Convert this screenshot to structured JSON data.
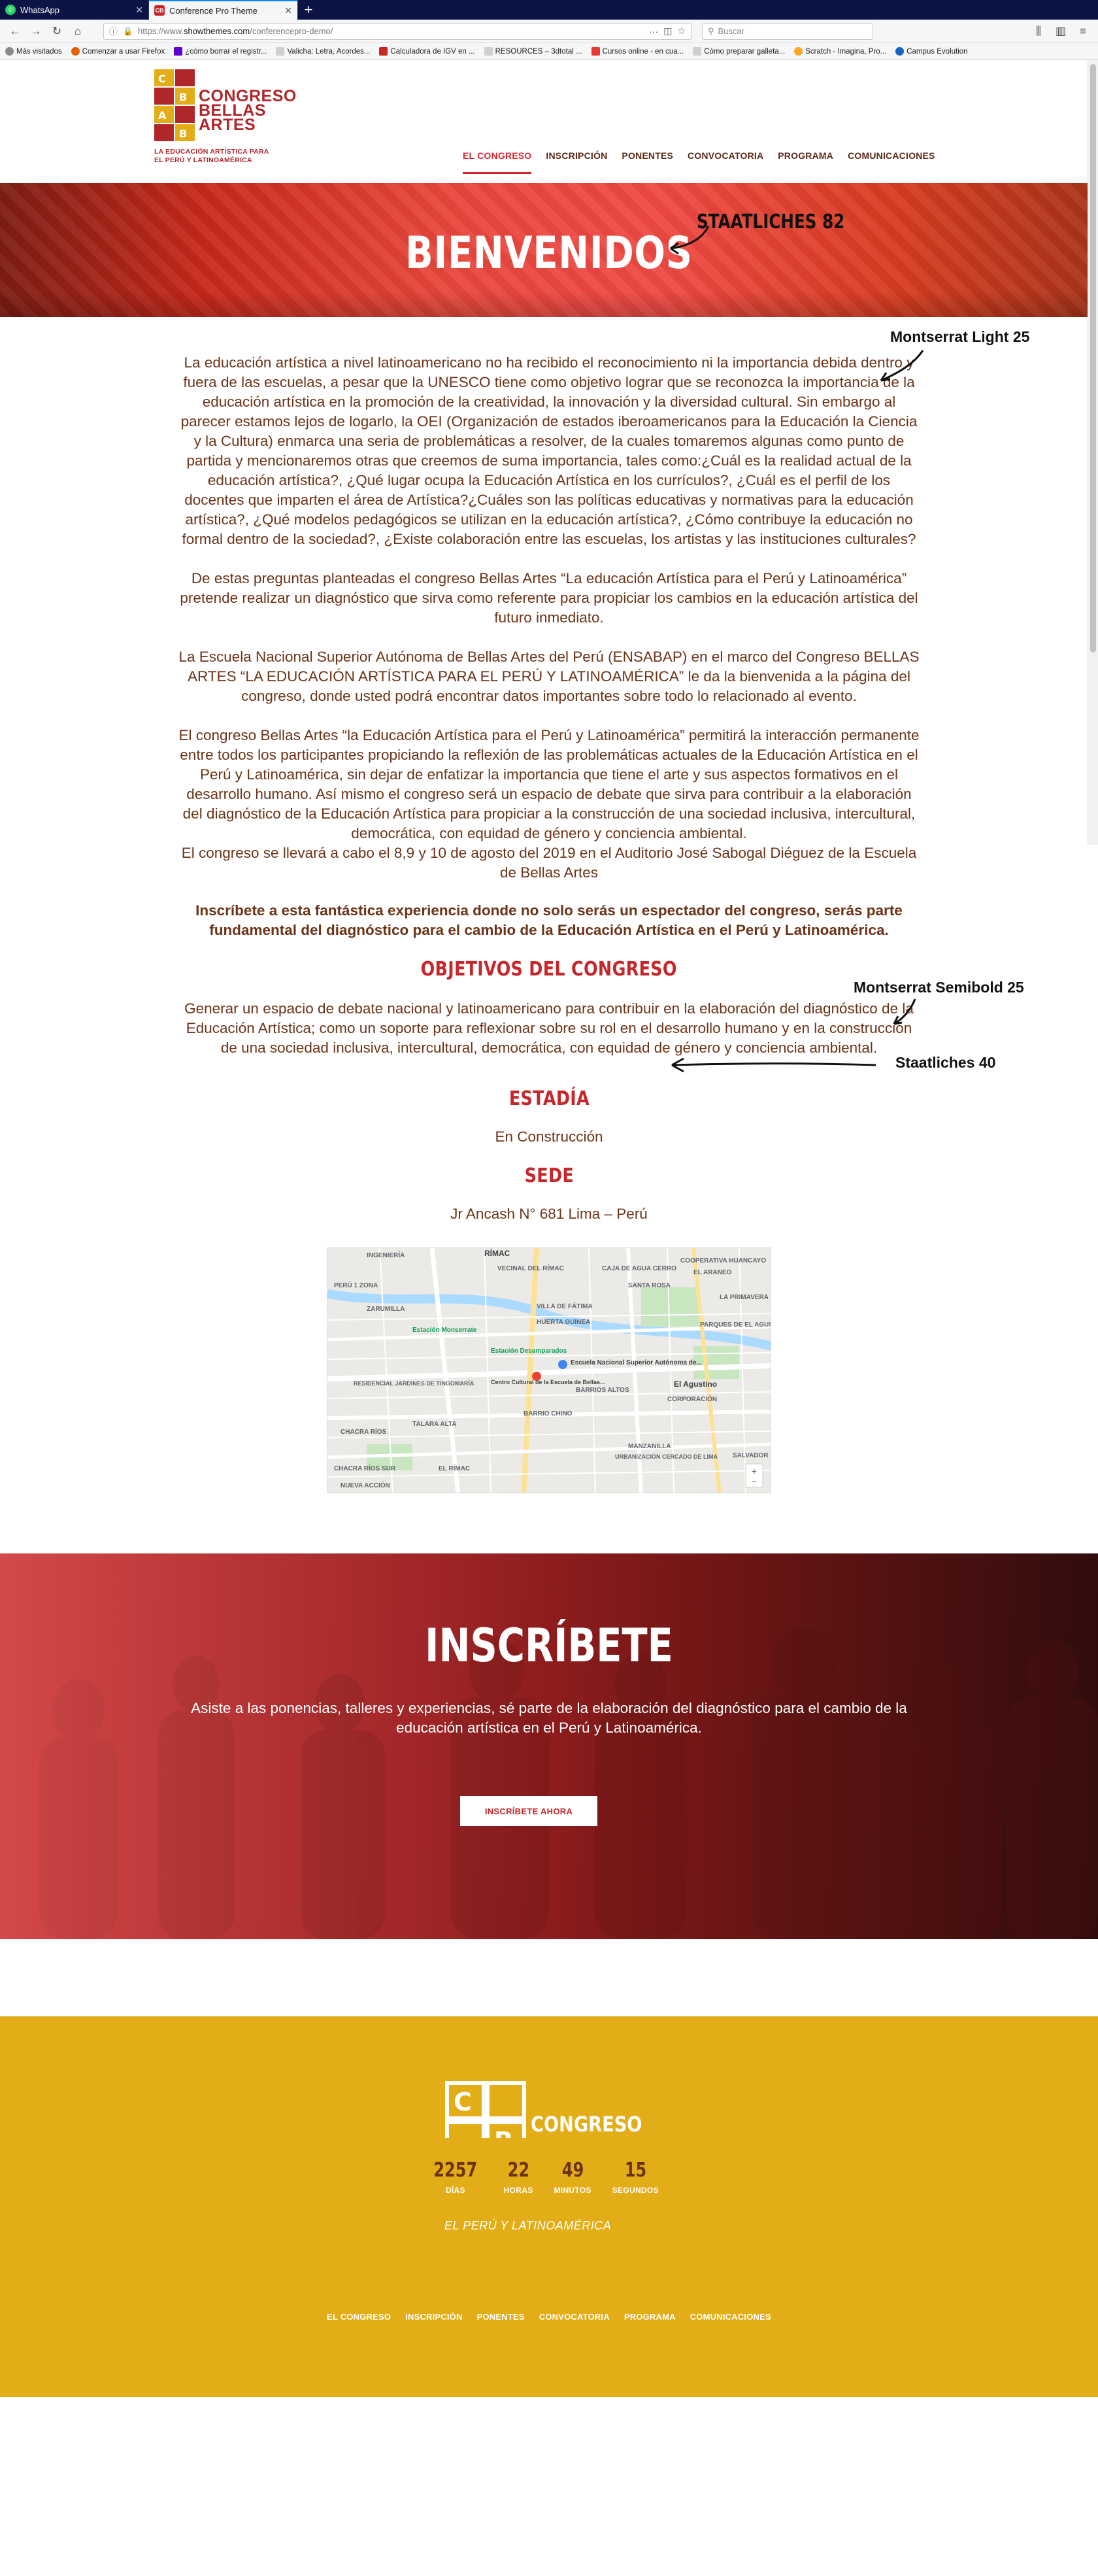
{
  "browser": {
    "tabs": [
      {
        "label": "WhatsApp",
        "favicon": "whatsapp-icon"
      },
      {
        "label": "Conference Pro Theme",
        "favicon": "cb-icon",
        "active": true
      }
    ],
    "url_prefix": "https://www.",
    "url_domain": "showthemes.com",
    "url_path": "/conferencepro-demo/",
    "search_placeholder": "Buscar",
    "bookmarks": [
      "Más visitados",
      "Comenzar a usar Firefox",
      "¿cómo borrar el registr...",
      "Valicha: Letra, Acordes...",
      "Calculadora de IGV en ...",
      "RESOURCES – 3dtotal ...",
      "Cursos online - en cua...",
      "Cómo preparar galleta...",
      "Scratch - Imagina, Pro...",
      "Campus Evolution"
    ]
  },
  "logo": {
    "word1": "CONGRESO",
    "word2": "BELLAS",
    "word3": "ARTES",
    "tag_line1": "LA EDUCACIÓN ARTÍSTICA PARA",
    "tag_line2": "EL PERÚ Y LATINOAMÉRICA",
    "brand_red": "#b0262a",
    "brand_yellow": "#e3ad17"
  },
  "nav": [
    {
      "label": "EL CONGRESO",
      "active": true
    },
    {
      "label": "INSCRIPCIÓN"
    },
    {
      "label": "PONENTES"
    },
    {
      "label": "CONVOCATORIA"
    },
    {
      "label": "PROGRAMA"
    },
    {
      "label": "COMUNICACIONES"
    }
  ],
  "hero": {
    "title": "BIENVENIDOS"
  },
  "annotations": {
    "staatliches82": "STAATLICHES 82",
    "montserrat_light": "Montserrat Light 25",
    "montserrat_semibold": "Montserrat Semibold 25",
    "staatliches40": "Staatliches 40"
  },
  "intro": {
    "p1": "La educación artística a nivel latinoamericano no ha recibido el reconocimiento ni la importancia debida dentro y fuera de las escuelas, a pesar que la UNESCO tiene como objetivo lograr que se reconozca la importancia de la educación artística en la promoción de la creatividad, la innovación y la diversidad cultural. Sin embargo al parecer estamos lejos de logarlo, la OEI (Organización de estados iberoamericanos para la Educación la Ciencia y la Cultura) enmarca una seria de problemáticas a resolver, de la cuales tomaremos algunas como punto de partida y mencionaremos otras que creemos de suma importancia, tales como:¿Cuál es la realidad actual de la educación artística?, ¿Qué lugar ocupa la Educación Artística en los currículos?, ¿Cuál es el perfil de los docentes que imparten el área de Artística?¿Cuáles son las políticas educativas y normativas para la educación artística?, ¿Qué modelos pedagógicos se utilizan en la educación artística?,  ¿Cómo contribuye la educación no formal dentro de la sociedad?, ¿Existe colaboración entre las escuelas, los artistas y las instituciones culturales?",
    "p2": "De estas preguntas planteadas el congreso Bellas Artes “La educación Artística para el Perú y Latinoamérica” pretende realizar un diagnóstico que sirva como referente para propiciar los cambios en la educación artística del futuro inmediato.",
    "p3": "La Escuela Nacional Superior Autónoma de Bellas Artes del Perú (ENSABAP) en el marco del Congreso BELLAS ARTES “LA EDUCACIÓN ARTÍSTICA PARA EL PERÚ Y LATINOAMÉRICA” le da la bienvenida a la página del congreso, donde usted podrá encontrar datos importantes sobre todo lo relacionado al evento.",
    "p4": "El congreso Bellas Artes “la Educación Artística para el Perú y Latinoamérica” permitirá la interacción permanente entre todos los participantes propiciando la reflexión de las problemáticas actuales de la Educación Artística en el Perú y Latinoamérica, sin dejar de enfatizar la importancia que tiene el arte y sus aspectos formativos en el desarrollo humano. Así mismo el congreso será un espacio de debate que sirva para contribuir a la elaboración del diagnóstico de la Educación Artística para propiciar a la construcción de una sociedad inclusiva, intercultural, democrática, con equidad de género y conciencia ambiental.",
    "p4b": "El congreso se llevará a cabo el 8,9 y 10 de agosto del 2019 en el Auditorio José Sabogal Diéguez de la Escuela de Bellas Artes",
    "p5": "Inscríbete a esta fantástica experiencia donde no solo serás un espectador del congreso, serás parte fundamental del diagnóstico para el cambio de la Educación Artística en el Perú y Latinoamérica."
  },
  "objetivos": {
    "title": "OBJETIVOS DEL CONGRESO",
    "text": "Generar un espacio de debate nacional y latinoamericano para contribuir en la elaboración del diagnóstico de la Educación Artística; como un soporte para reflexionar sobre su rol en el desarrollo humano y en la construcción de una sociedad inclusiva, intercultural, democrática, con equidad de género y conciencia ambiental."
  },
  "estadia": {
    "title": "ESTADÍA",
    "text": "En Construcción"
  },
  "sede": {
    "title": "SEDE",
    "text": "Jr Ancash N° 681 Lima – Perú"
  },
  "map": {
    "labels": [
      "INGENIERÍA",
      "RÍMAC",
      "PERÚ 1 ZONA",
      "ZARUMILLA",
      "VILLA DE FÁTIMA",
      "HUERTA GUINEA",
      "Estación Monserrate",
      "Estación Desamparados",
      "Escuela Nacional Superior Autónoma de...",
      "Centro Cultural de la Escuela de Bellas...",
      "BARRIOS ALTOS",
      "El Agustino",
      "CORPORACIÓN",
      "BARRIO CHINO",
      "RESIDENCIAL JARDINES DE TINGOMARÍA",
      "TALARA ALTA",
      "CHACRA RÍOS",
      "MANZANILLA",
      "URBANIZACIÓN CERCADO DE LIMA",
      "SALVADOR",
      "CAJA DE AGUA CERRO",
      "SANTA ROSA",
      "PARQUES DE EL AGUSTINO",
      "LA PRIMAVERA",
      "EL ARANEO",
      "VECINAL DEL RÍMAC",
      "COOPERATIVA HUANCAYO",
      "CHACRA RÍOS SUR",
      "NUEVA ACCIÓN",
      "EL RÍMAC"
    ]
  },
  "inscribete": {
    "title": "INSCRÍBETE",
    "text": "Asiste a las ponencias, talleres y experiencias, sé parte de la elaboración del diagnóstico para el cambio de la educación artística en el Perú y Latinoamérica.",
    "button": "INSCRÍBETE AHORA"
  },
  "countdown": [
    {
      "value": "2257",
      "label": "DÍAS"
    },
    {
      "value": "22",
      "label": "HORAS"
    },
    {
      "value": "49",
      "label": "MINUTOS"
    },
    {
      "value": "15",
      "label": "SEGUNDOS"
    }
  ],
  "footer": {
    "nav": [
      "EL CONGRESO",
      "INSCRIPCIÓN",
      "PONENTES",
      "CONVOCATORIA",
      "PROGRAMA",
      "COMUNICACIONES"
    ]
  }
}
